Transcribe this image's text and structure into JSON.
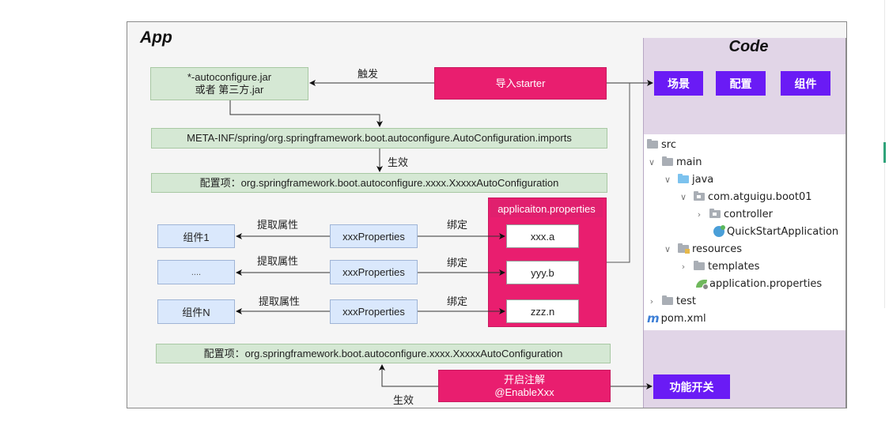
{
  "app": {
    "title": "App",
    "jar_box": {
      "line1": "*-autoconfigure.jar",
      "line2": "或者  第三方.jar"
    },
    "trigger_label": "触发",
    "import_starter": "导入starter",
    "imports_file": "META-INF/spring/org.springframework.boot.autoconfigure.AutoConfiguration.imports",
    "effect_label": "生效",
    "config_item_top": "配置项：org.springframework.boot.autoconfigure.xxxx.XxxxxAutoConfiguration",
    "rows": [
      {
        "component": "组件1",
        "extract_label": "提取属性",
        "properties": "xxxProperties",
        "bind_label": "绑定",
        "property_key": "xxx.a"
      },
      {
        "component": "....",
        "extract_label": "提取属性",
        "properties": "xxxProperties",
        "bind_label": "绑定",
        "property_key": "yyy.b"
      },
      {
        "component": "组件N",
        "extract_label": "提取属性",
        "properties": "xxxProperties",
        "bind_label": "绑定",
        "property_key": "zzz.n"
      }
    ],
    "properties_file_title": "applicaiton.properties",
    "config_item_bottom": "配置项：org.springframework.boot.autoconfigure.xxxx.XxxxxAutoConfiguration",
    "enable_box": {
      "line1": "开启注解",
      "line2": "@EnableXxx"
    },
    "effect_label_bottom": "生效"
  },
  "code": {
    "title": "Code",
    "buttons": [
      "场景",
      "配置",
      "组件"
    ],
    "feature_switch": "功能开关",
    "tree": [
      {
        "label": "src",
        "icon": "folder-icon",
        "chevron": "",
        "indent": 0
      },
      {
        "label": "main",
        "icon": "folder-icon",
        "chevron": "∨",
        "indent": 0
      },
      {
        "label": "java",
        "icon": "source-folder-icon",
        "chevron": "∨",
        "indent": 1
      },
      {
        "label": "com.atguigu.boot01",
        "icon": "package-icon",
        "chevron": "∨",
        "indent": 2
      },
      {
        "label": "controller",
        "icon": "package-icon",
        "chevron": "›",
        "indent": 3
      },
      {
        "label": "QuickStartApplication",
        "icon": "spring-class-icon",
        "chevron": "",
        "indent": 4
      },
      {
        "label": "resources",
        "icon": "resources-folder-icon",
        "chevron": "∨",
        "indent": 1
      },
      {
        "label": "templates",
        "icon": "folder-icon",
        "chevron": "›",
        "indent": 2
      },
      {
        "label": "application.properties",
        "icon": "spring-properties-icon",
        "chevron": "",
        "indent": 3
      },
      {
        "label": "test",
        "icon": "folder-icon",
        "chevron": "›",
        "indent": 0
      },
      {
        "label": "pom.xml",
        "icon": "maven-icon",
        "chevron": "",
        "indent": -1
      }
    ]
  },
  "colors": {
    "green_box": "#d5e8d4",
    "blue_box": "#dae8fc",
    "pink": "#e91e6f",
    "purple": "#6a1bf5",
    "code_panel": "#e1d5e7"
  }
}
